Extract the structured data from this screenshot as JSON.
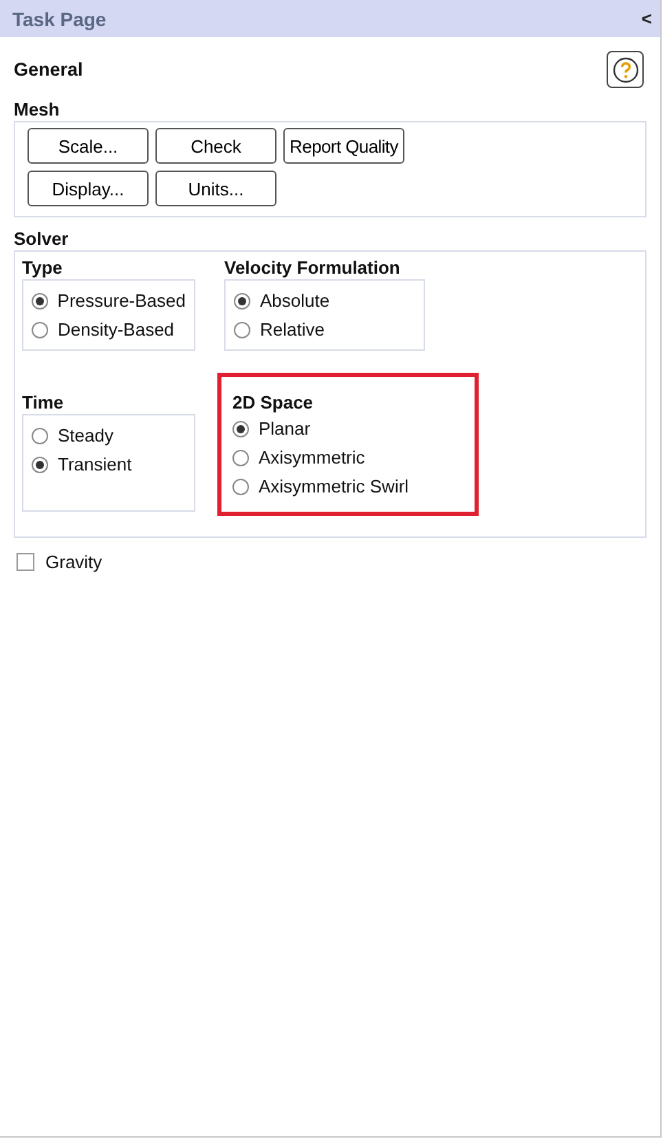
{
  "window": {
    "title": "Task Page",
    "collapse": "<"
  },
  "page": {
    "title": "General"
  },
  "mesh": {
    "label": "Mesh",
    "buttons": [
      [
        "Scale...",
        "Check",
        "Report Quality"
      ],
      [
        "Display...",
        "Units..."
      ]
    ]
  },
  "solver": {
    "label": "Solver",
    "groups": [
      {
        "label": "Type",
        "highlighted": false,
        "options": [
          {
            "label": "Pressure-Based",
            "selected": true
          },
          {
            "label": "Density-Based",
            "selected": false
          }
        ]
      },
      {
        "label": "Velocity Formulation",
        "highlighted": false,
        "options": [
          {
            "label": "Absolute",
            "selected": true
          },
          {
            "label": "Relative",
            "selected": false
          }
        ]
      },
      {
        "label": "Time",
        "highlighted": false,
        "options": [
          {
            "label": "Steady",
            "selected": false
          },
          {
            "label": "Transient",
            "selected": true
          }
        ]
      },
      {
        "label": "2D Space",
        "highlighted": true,
        "options": [
          {
            "label": "Planar",
            "selected": true
          },
          {
            "label": "Axisymmetric",
            "selected": false
          },
          {
            "label": "Axisymmetric Swirl",
            "selected": false
          }
        ]
      }
    ]
  },
  "gravity": {
    "label": "Gravity",
    "checked": false
  }
}
